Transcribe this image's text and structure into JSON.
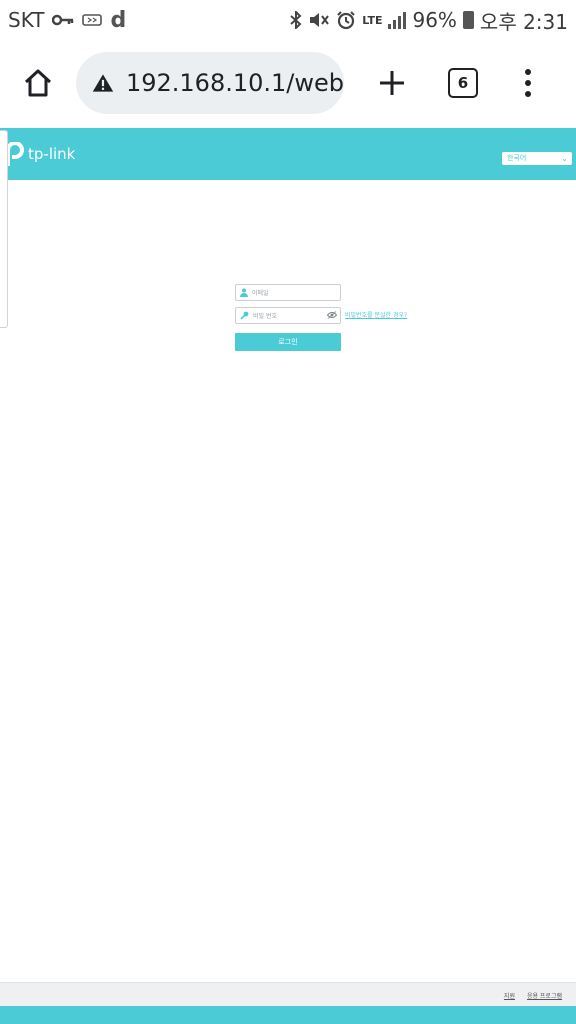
{
  "status_bar": {
    "carrier": "SKT",
    "notification_d": "d",
    "network_label": "LTE",
    "battery_percent": "96%",
    "time": "오후 2:31"
  },
  "browser": {
    "url": "192.168.10.1/web",
    "tab_count": "6",
    "icons": [
      "home-icon",
      "not-secure-warning-icon",
      "new-tab-plus-icon",
      "tab-switcher-icon",
      "overflow-menu-icon"
    ]
  },
  "router_page": {
    "brand": "tp-link",
    "language_selected": "한국어",
    "username_placeholder": "이메일",
    "password_placeholder": "비밀 번호",
    "forgot_password_link": "비밀번호를 분실한 경우?",
    "login_button": "로그인",
    "footer_links": [
      "지원",
      "응용 프로그램"
    ],
    "colors": {
      "accent": "#4acbd6"
    }
  }
}
